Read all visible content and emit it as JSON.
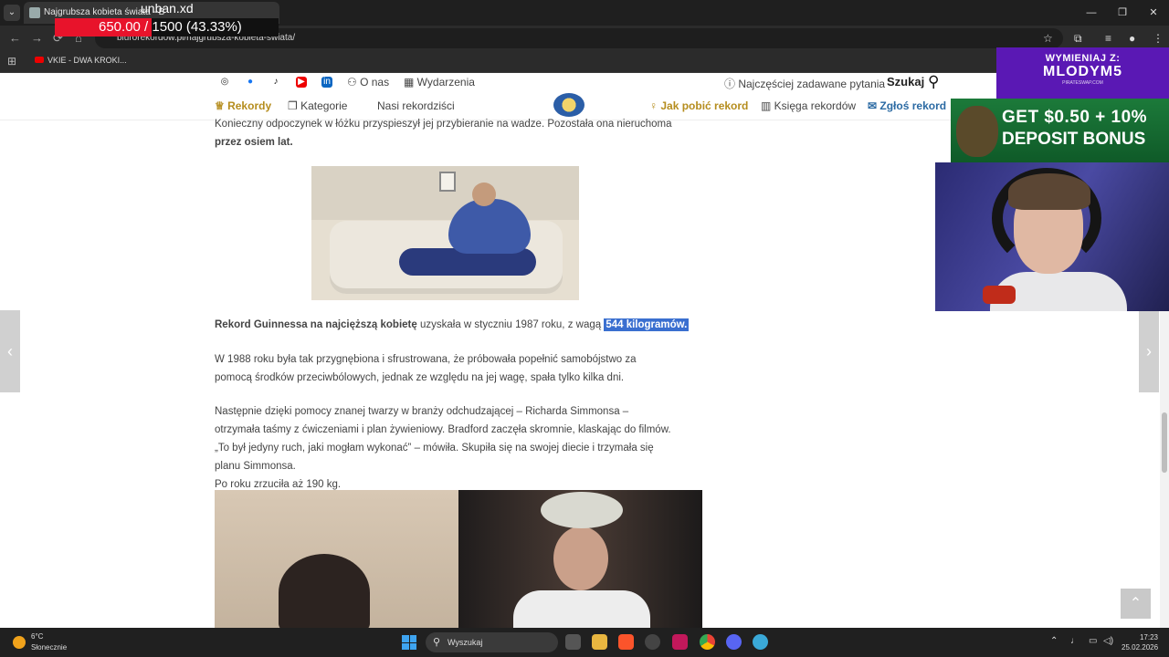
{
  "browser": {
    "tab_title": "Najgrubsza kobieta świata - B",
    "url": "biurorekordow.pl/najgrubsza-kobieta-swiata/",
    "bookmark": "VKIE - DWA KROKI...",
    "window_controls": [
      "—",
      "❐",
      "✕"
    ]
  },
  "overlay": {
    "username": "unban.xd",
    "progress_text": "650.00 / 1500 (43.33%)",
    "progress_value": 650,
    "progress_max": 1500
  },
  "site": {
    "header_links": {
      "about": "O nas",
      "events": "Wydarzenia",
      "faq": "Najczęściej zadawane pytania",
      "search": "Szukaj"
    },
    "menu": {
      "records": "Rekordy",
      "categories": "Kategorie",
      "record_holders": "Nasi rekordziści",
      "how_to": "Jak pobić rekord",
      "book": "Księga rekordów",
      "submit": "Zgłoś rekord"
    }
  },
  "article": {
    "p1_normal": "Konieczny odpoczynek w łóżku przyspieszył jej przybieranie na wadze. Pozostała ona nieruchoma",
    "p1_bold": "przez osiem lat.",
    "p2_bold": "Rekord Guinnessa na najcięższą kobietę",
    "p2_normal": " uzyskała w styczniu 1987 roku, z wagą ",
    "p2_highlight": "544 kilogramów.",
    "p3": "W 1988 roku była tak przygnębiona i sfrustrowana, że próbowała popełnić samobójstwo za pomocą środków przeciwbólowych, jednak ze względu na jej wagę, spała tylko kilka dni.",
    "p4a": "Następnie dzięki pomocy znanej twarzy w branży odchudzającej – Richarda Simmonsa – otrzymała taśmy z ćwiczeniami i plan żywieniowy. Bradford zaczęła skromnie, klaskając do filmów. „To był jedyny ruch, jaki mogłam wykonać” – mówiła. Skupiła się na swojej diecie i trzymała się planu Simmonsa.",
    "p4b": "Po roku zrzuciła aż 190 kg."
  },
  "stream": {
    "banner_line1": "WYMIENIAJ Z:",
    "banner_line2": "MLODYM5",
    "banner_line3": "PIRATESWAP.COM",
    "ad_line1": "GET $0.50 + 10%",
    "ad_line2": "DEPOSIT BONUS"
  },
  "taskbar": {
    "temperature": "6°C",
    "weather": "Słonecznie",
    "search_placeholder": "Wyszukaj",
    "time": "17:23",
    "date": "25.02.2026"
  },
  "colors": {
    "accent_gold": "#b58d1e",
    "accent_blue": "#2b6aa3",
    "highlight": "#3a6fd0",
    "overlay_red": "#e8132b",
    "banner_purple": "#5a18b4"
  }
}
